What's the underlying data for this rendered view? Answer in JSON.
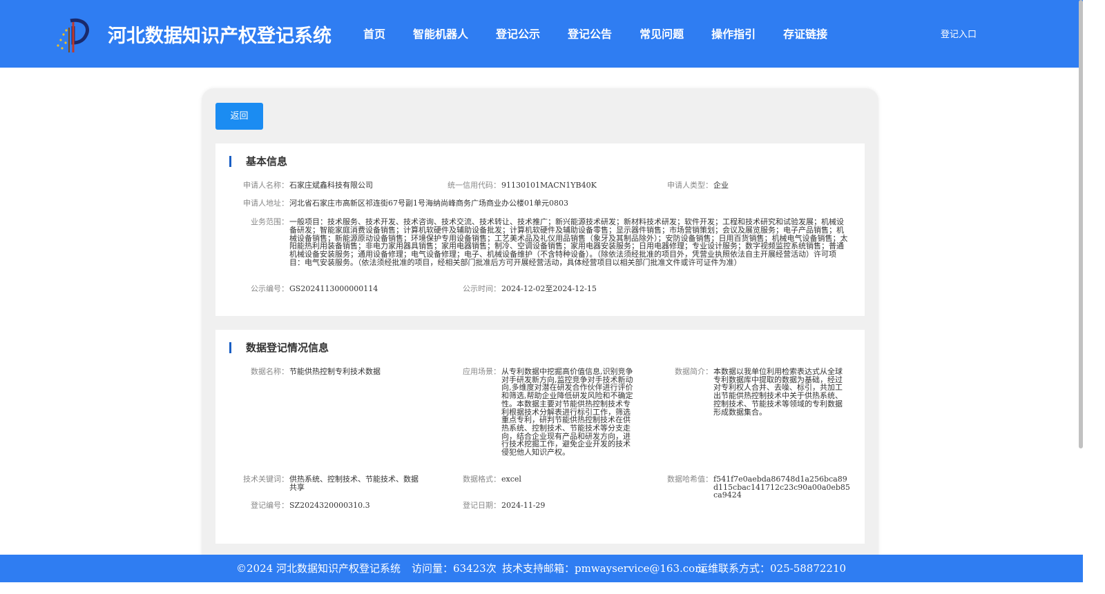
{
  "header": {
    "title": "河北数据知识产权登记系统",
    "nav": [
      "首页",
      "智能机器人",
      "登记公示",
      "登记公告",
      "常见问题",
      "操作指引",
      "存证链接"
    ],
    "login": "登记入口"
  },
  "back_label": "返回",
  "basic_info": {
    "title": "基本信息",
    "applicant_name_label": "申请人名称：",
    "applicant_name": "石家庄斌鑫科技有限公司",
    "credit_code_label": "统一信用代码：",
    "credit_code": "91130101MACN1YB40K",
    "applicant_type_label": "申请人类型：",
    "applicant_type": "企业",
    "address_label": "申请人地址：",
    "address": "河北省石家庄市高新区祁连街67号副1号海纳尚峰商务广场商业办公楼01单元0803",
    "scope_label": "业务范围：",
    "scope": "一般项目：技术服务、技术开发、技术咨询、技术交流、技术转让、技术推广；新兴能源技术研发；新材料技术研发；软件开发；工程和技术研究和试验发展；机械设备研发；智能家庭消费设备销售；计算机软硬件及辅助设备批发；计算机软硬件及辅助设备零售；显示器件销售；市场营销策划；会议及展览服务；电子产品销售；机械设备销售；新能源原动设备销售；环境保护专用设备销售；工艺美术品及礼仪用品销售（象牙及其制品除外）；安防设备销售；日用百货销售；机械电气设备销售；太阳能热利用装备销售；非电力家用器具销售；家用电器销售；制冷、空调设备销售；家用电器安装服务；日用电器修理；专业设计服务；数字视频监控系统销售；普通机械设备安装服务；通用设备修理；电气设备修理；电子、机械设备维护（不含特种设备）。（除依法须经批准的项目外，凭营业执照依法自主开展经营活动）许可项目：电气安装服务。（依法须经批准的项目，经相关部门批准后方可开展经营活动，具体经营项目以相关部门批准文件或许可证件为准）",
    "notice_no_label": "公示编号：",
    "notice_no": "GS2024113000000114",
    "notice_time_label": "公示时间：",
    "notice_time": "2024-12-02至2024-12-15"
  },
  "data_info": {
    "title": "数据登记情况信息",
    "data_name_label": "数据名称：",
    "data_name": "节能供热控制专利技术数据",
    "scenario_label": "应用场景：",
    "scenario": "从专利数据中挖掘高价值信息,识别竞争对手研发新方向,监控竞争对手技术新动向,多维度对潜在研发合作伙伴进行评价和筛选,帮助企业降低研发风险和不确定性。本数据主要对节能供热控制技术专利根据技术分解表进行标引工作，筛选重点专利，研判节能供热控制技术在供热系统、控制技术、节能技术等分支走向，结合企业现有产品和研发方向，进行技术挖掘工作，避免企业开发的技术侵犯他人知识产权。",
    "intro_label": "数据简介：",
    "intro": "本数据以我单位利用检索表达式从全球专利数据库中提取的数据为基础，经过对专利权人合并、去噪、标引，共加工出节能供热控制技术中关于供热系统、控制技术、节能技术等领域的专利数据形成数据集合。",
    "keywords_label": "技术关键词：",
    "keywords": "供热系统、控制技术、节能技术、数据共享",
    "format_label": "数据格式：",
    "format": "excel",
    "hash_label": "数据哈希值：",
    "hash": "f541f7e0aebda86748d1a256bca89d115cbac141712c23c90a00a0eb85ca9424",
    "reg_no_label": "登记编号：",
    "reg_no": "SZ2024320000310.3",
    "reg_date_label": "登记日期：",
    "reg_date": "2024-11-29"
  },
  "footer": {
    "copyright": "©2024 河北数据知识产权登记系统",
    "visits": "访问量：63423次",
    "email": "技术支持邮箱：pmwayservice@163.com",
    "phone": "运维联系方式：025-58872210"
  },
  "colors": {
    "header_bg": "#2f7df2",
    "button_bg": "#1b8cf2",
    "section_marker": "#1a5fc4"
  }
}
